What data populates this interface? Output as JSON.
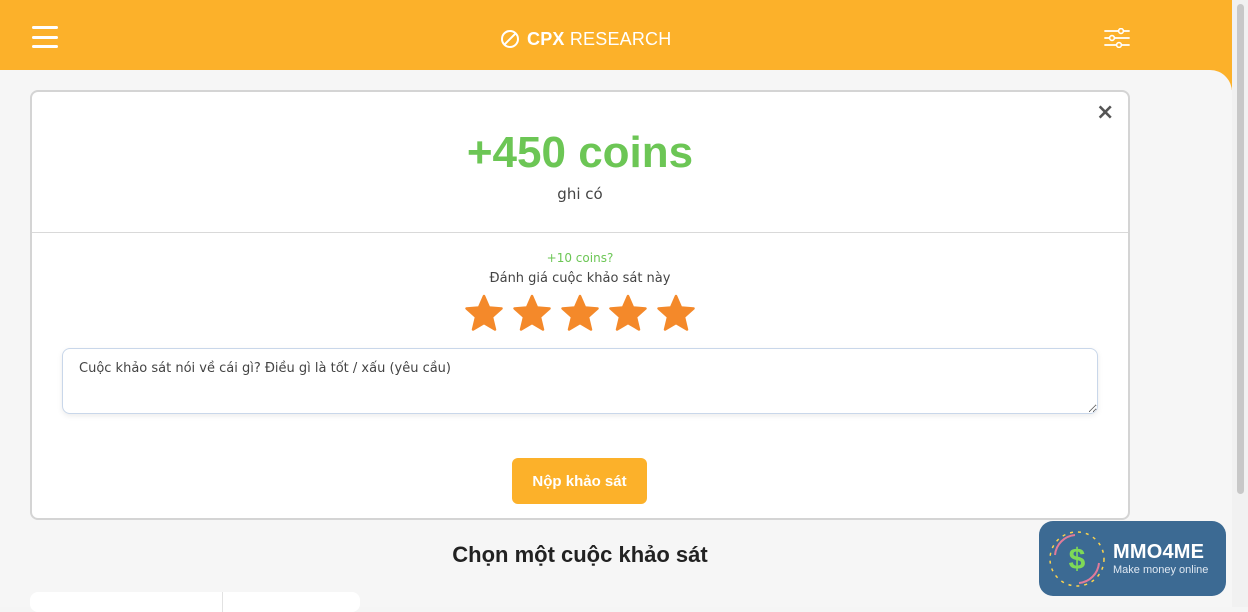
{
  "header": {
    "brand_bold": "CPX",
    "brand_light": "RESEARCH",
    "menu_icon": "hamburger-icon",
    "filter_icon": "sliders-icon",
    "color": "#fcb12a"
  },
  "modal": {
    "close_label": "×",
    "coins_credited": "+450 coins",
    "credited_label": "ghi có",
    "bonus_label": "+10 coins?",
    "rate_label": "Đánh giá cuộc khảo sát này",
    "rating_max": 5,
    "star_color": "#f4892a",
    "comment_placeholder": "Cuộc khảo sát nói về cái gì? Điều gì là tốt / xấu (yêu cầu)",
    "comment_value": "",
    "submit_label": "Nộp khảo sát",
    "accent_green": "#6cc655"
  },
  "section_title": "Chọn một cuộc khảo sát",
  "watermark": {
    "title": "MMO4ME",
    "subtitle": "Make money online",
    "icon": "dollar-coin-icon"
  }
}
